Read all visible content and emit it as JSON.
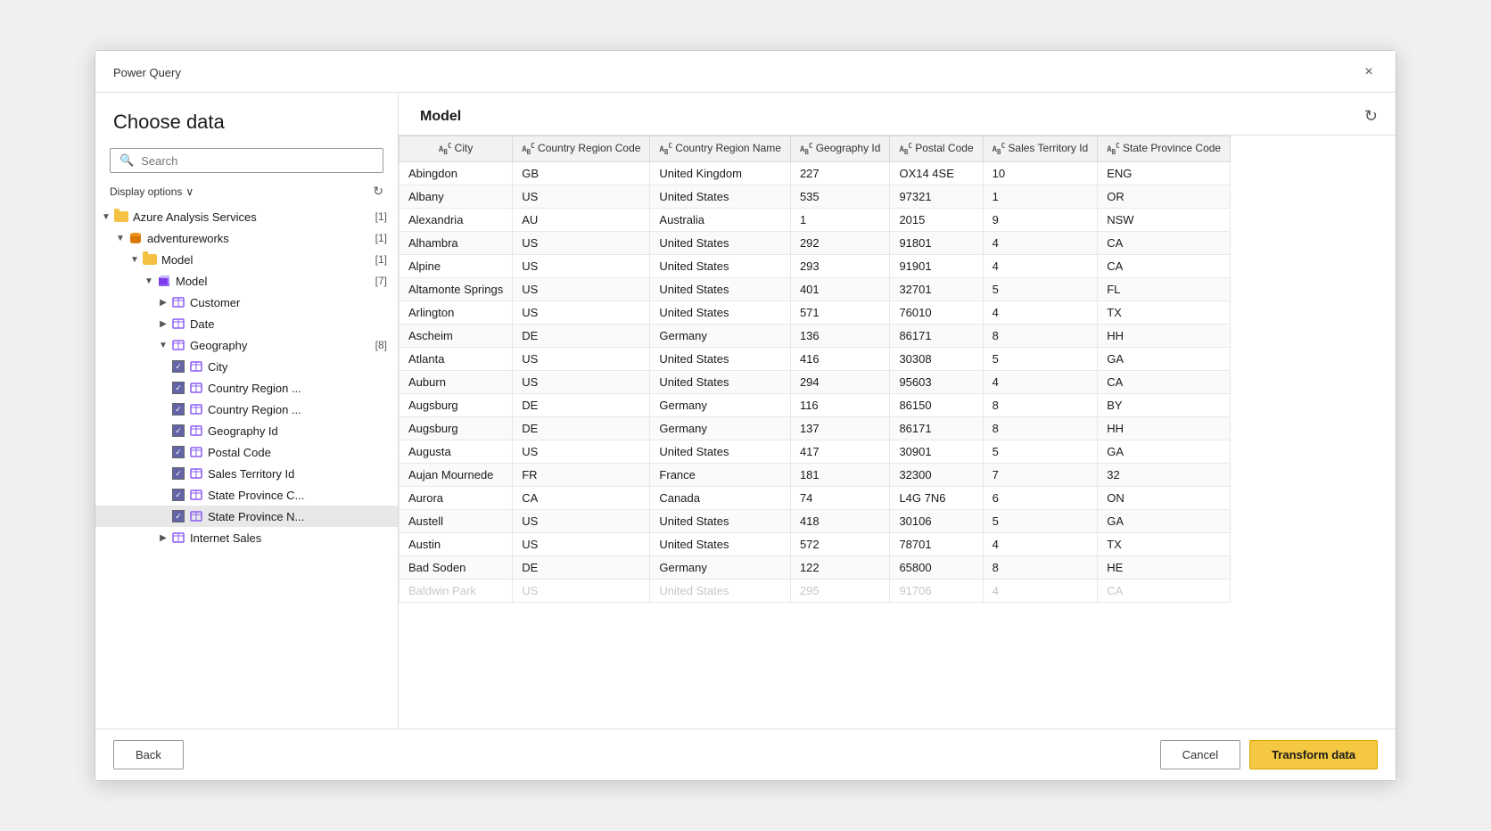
{
  "dialog": {
    "title": "Power Query",
    "close_label": "×"
  },
  "left": {
    "heading": "Choose data",
    "search_placeholder": "Search",
    "display_options_label": "Display options",
    "display_options_chevron": "∨",
    "tree": [
      {
        "id": "azure-analysis",
        "level": 0,
        "arrow": "▼",
        "icon": "folder",
        "label": "Azure Analysis Services",
        "count": "[1]",
        "expanded": true
      },
      {
        "id": "adventureworks",
        "level": 1,
        "arrow": "▼",
        "icon": "db",
        "label": "adventureworks",
        "count": "[1]",
        "expanded": true
      },
      {
        "id": "model-folder",
        "level": 2,
        "arrow": "▼",
        "icon": "folder",
        "label": "Model",
        "count": "[1]",
        "expanded": true
      },
      {
        "id": "model-cube",
        "level": 3,
        "arrow": "▼",
        "icon": "cube",
        "label": "Model",
        "count": "[7]",
        "expanded": true
      },
      {
        "id": "customer",
        "level": 4,
        "arrow": "▶",
        "icon": "table",
        "label": "Customer",
        "count": "",
        "expanded": false,
        "checkbox": false
      },
      {
        "id": "date",
        "level": 4,
        "arrow": "▶",
        "icon": "table",
        "label": "Date",
        "count": "",
        "expanded": false,
        "checkbox": false
      },
      {
        "id": "geography",
        "level": 4,
        "arrow": "▼",
        "icon": "table",
        "label": "Geography",
        "count": "[8]",
        "expanded": true,
        "checkbox": false
      },
      {
        "id": "city",
        "level": 5,
        "arrow": "",
        "icon": "field",
        "label": "City",
        "count": "",
        "checked": true,
        "checkbox": true
      },
      {
        "id": "country-region-code",
        "level": 5,
        "arrow": "",
        "icon": "field",
        "label": "Country Region ...",
        "count": "",
        "checked": true,
        "checkbox": true
      },
      {
        "id": "country-region-name",
        "level": 5,
        "arrow": "",
        "icon": "field",
        "label": "Country Region ...",
        "count": "",
        "checked": true,
        "checkbox": true
      },
      {
        "id": "geography-id",
        "level": 5,
        "arrow": "",
        "icon": "field",
        "label": "Geography Id",
        "count": "",
        "checked": true,
        "checkbox": true
      },
      {
        "id": "postal-code",
        "level": 5,
        "arrow": "",
        "icon": "field",
        "label": "Postal Code",
        "count": "",
        "checked": true,
        "checkbox": true
      },
      {
        "id": "sales-territory-id",
        "level": 5,
        "arrow": "",
        "icon": "field",
        "label": "Sales Territory Id",
        "count": "",
        "checked": true,
        "checkbox": true
      },
      {
        "id": "state-province-c",
        "level": 5,
        "arrow": "",
        "icon": "field",
        "label": "State Province C...",
        "count": "",
        "checked": true,
        "checkbox": true
      },
      {
        "id": "state-province-n",
        "level": 5,
        "arrow": "",
        "icon": "field",
        "label": "State Province N...",
        "count": "",
        "checked": true,
        "checkbox": true,
        "selected": true
      },
      {
        "id": "internet-sales",
        "level": 4,
        "arrow": "▶",
        "icon": "table",
        "label": "Internet Sales",
        "count": "",
        "expanded": false,
        "checkbox": false
      }
    ]
  },
  "right": {
    "model_title": "Model",
    "refresh_icon": "↻",
    "columns": [
      {
        "label": "City",
        "type": "AB"
      },
      {
        "label": "Country Region Code",
        "type": "AB"
      },
      {
        "label": "Country Region Name",
        "type": "AB"
      },
      {
        "label": "Geography Id",
        "type": "AB"
      },
      {
        "label": "Postal Code",
        "type": "AB"
      },
      {
        "label": "Sales Territory Id",
        "type": "AB"
      },
      {
        "label": "State Province Code",
        "type": "AB"
      }
    ],
    "rows": [
      [
        "Abingdon",
        "GB",
        "United Kingdom",
        "227",
        "OX14 4SE",
        "10",
        "ENG"
      ],
      [
        "Albany",
        "US",
        "United States",
        "535",
        "97321",
        "1",
        "OR"
      ],
      [
        "Alexandria",
        "AU",
        "Australia",
        "1",
        "2015",
        "9",
        "NSW"
      ],
      [
        "Alhambra",
        "US",
        "United States",
        "292",
        "91801",
        "4",
        "CA"
      ],
      [
        "Alpine",
        "US",
        "United States",
        "293",
        "91901",
        "4",
        "CA"
      ],
      [
        "Altamonte Springs",
        "US",
        "United States",
        "401",
        "32701",
        "5",
        "FL"
      ],
      [
        "Arlington",
        "US",
        "United States",
        "571",
        "76010",
        "4",
        "TX"
      ],
      [
        "Ascheim",
        "DE",
        "Germany",
        "136",
        "86171",
        "8",
        "HH"
      ],
      [
        "Atlanta",
        "US",
        "United States",
        "416",
        "30308",
        "5",
        "GA"
      ],
      [
        "Auburn",
        "US",
        "United States",
        "294",
        "95603",
        "4",
        "CA"
      ],
      [
        "Augsburg",
        "DE",
        "Germany",
        "116",
        "86150",
        "8",
        "BY"
      ],
      [
        "Augsburg",
        "DE",
        "Germany",
        "137",
        "86171",
        "8",
        "HH"
      ],
      [
        "Augusta",
        "US",
        "United States",
        "417",
        "30901",
        "5",
        "GA"
      ],
      [
        "Aujan Mournede",
        "FR",
        "France",
        "181",
        "32300",
        "7",
        "32"
      ],
      [
        "Aurora",
        "CA",
        "Canada",
        "74",
        "L4G 7N6",
        "6",
        "ON"
      ],
      [
        "Austell",
        "US",
        "United States",
        "418",
        "30106",
        "5",
        "GA"
      ],
      [
        "Austin",
        "US",
        "United States",
        "572",
        "78701",
        "4",
        "TX"
      ],
      [
        "Bad Soden",
        "DE",
        "Germany",
        "122",
        "65800",
        "8",
        "HE"
      ],
      [
        "Baldwin Park",
        "US",
        "United States",
        "295",
        "91706",
        "4",
        "CA"
      ]
    ]
  },
  "bottom": {
    "back_label": "Back",
    "cancel_label": "Cancel",
    "transform_label": "Transform data"
  }
}
